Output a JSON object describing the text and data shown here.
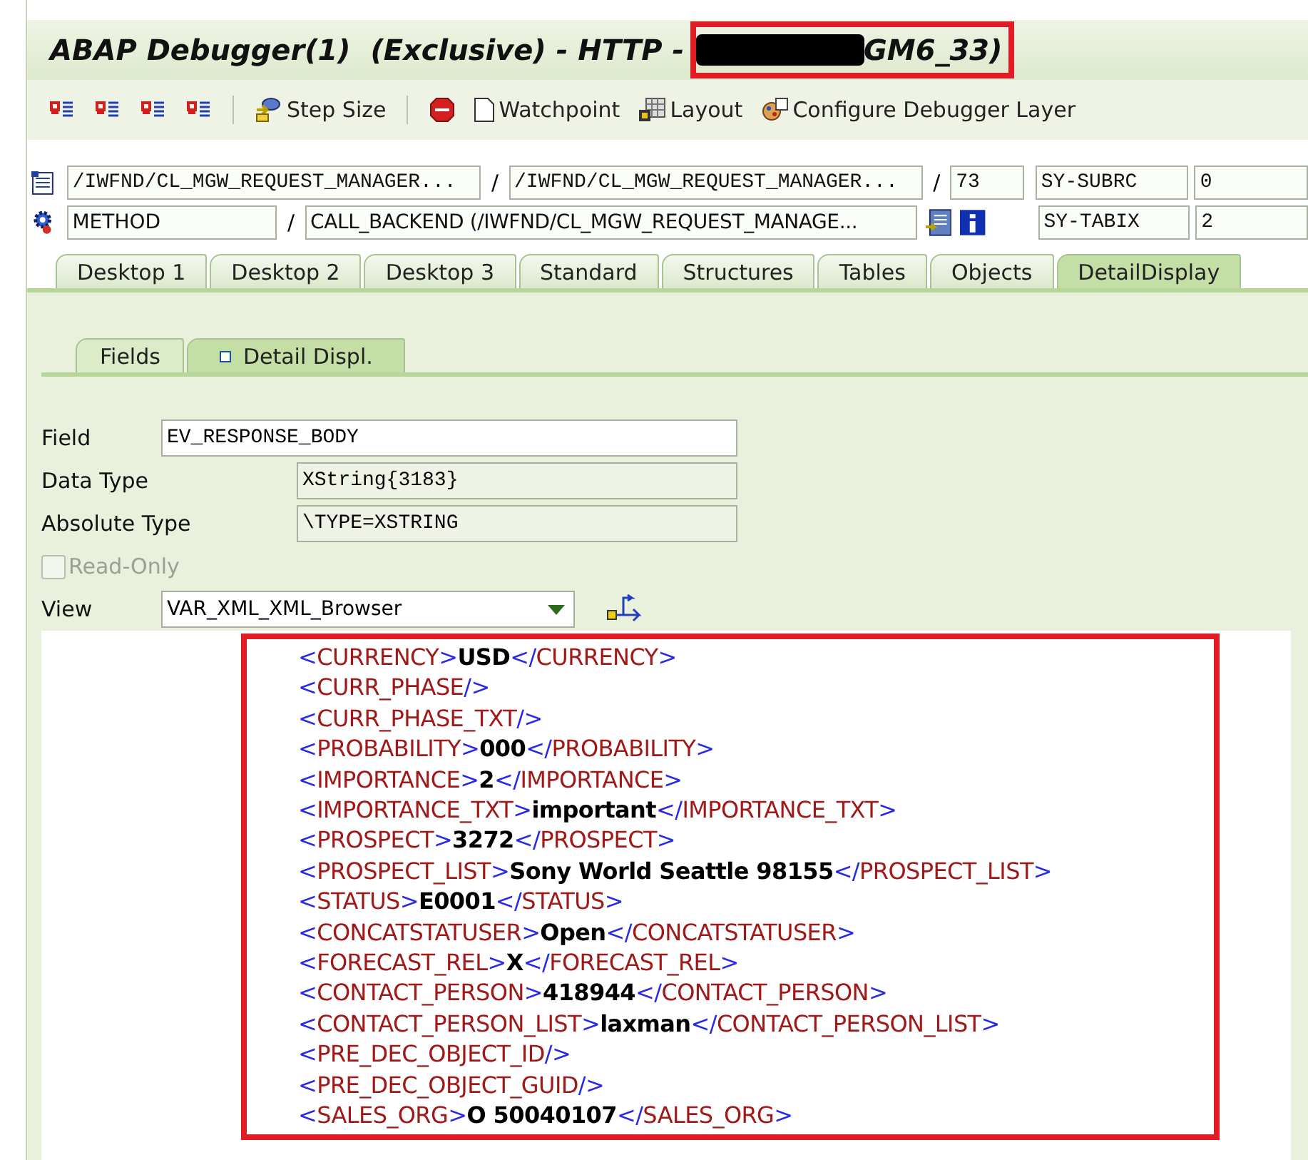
{
  "window": {
    "title": "ABAP Debugger(1)  (Exclusive) - HTTP -",
    "title_suffix": "GM6_33)"
  },
  "toolbar": [
    {
      "label": "Step Size"
    },
    {
      "label": "Watchpoint"
    },
    {
      "label": "Layout"
    },
    {
      "label": "Configure Debugger Layer"
    }
  ],
  "position": {
    "program": "/IWFND/CL_MGW_REQUEST_MANAGER...",
    "include": "/IWFND/CL_MGW_REQUEST_MANAGER...",
    "line": "73",
    "type": "METHOD",
    "routine": "CALL_BACKEND (/IWFND/CL_MGW_REQUEST_MANAGE...",
    "separator": "/",
    "sy": [
      {
        "name": "SY-SUBRC",
        "value": "0"
      },
      {
        "name": "SY-TABIX",
        "value": "2"
      }
    ]
  },
  "tabs": [
    {
      "label": "Desktop 1",
      "selected": false
    },
    {
      "label": "Desktop 2",
      "selected": false
    },
    {
      "label": "Desktop 3",
      "selected": false
    },
    {
      "label": "Standard",
      "selected": false
    },
    {
      "label": "Structures",
      "selected": false
    },
    {
      "label": "Tables",
      "selected": false
    },
    {
      "label": "Objects",
      "selected": false
    },
    {
      "label": "DetailDisplay",
      "selected": true
    }
  ],
  "subtabs": [
    {
      "label": "Fields",
      "selected": false
    },
    {
      "label": "Detail Displ.",
      "selected": true
    }
  ],
  "form": {
    "field_label": "Field",
    "field_value": "EV_RESPONSE_BODY",
    "data_type_label": "Data Type",
    "data_type_value": "XString{3183}",
    "absolute_type_label": "Absolute Type",
    "absolute_type_value": "\\TYPE=XSTRING",
    "read_only": {
      "label": "Read-Only",
      "checked": false,
      "disabled": true
    },
    "view_label": "View",
    "view_value": "VAR_XML_XML_Browser"
  },
  "xml_lines": [
    [
      {
        "kind": "punct",
        "text": "<"
      },
      {
        "kind": "name",
        "text": "CURRENCY"
      },
      {
        "kind": "punct",
        "text": ">"
      },
      {
        "kind": "value",
        "text": "USD"
      },
      {
        "kind": "punct",
        "text": "</"
      },
      {
        "kind": "name",
        "text": "CURRENCY"
      },
      {
        "kind": "punct",
        "text": ">"
      }
    ],
    [
      {
        "kind": "punct",
        "text": "<"
      },
      {
        "kind": "name",
        "text": "CURR_PHASE"
      },
      {
        "kind": "punct",
        "text": "/>"
      }
    ],
    [
      {
        "kind": "punct",
        "text": "<"
      },
      {
        "kind": "name",
        "text": "CURR_PHASE_TXT"
      },
      {
        "kind": "punct",
        "text": "/>"
      }
    ],
    [
      {
        "kind": "punct",
        "text": "<"
      },
      {
        "kind": "name",
        "text": "PROBABILITY"
      },
      {
        "kind": "punct",
        "text": ">"
      },
      {
        "kind": "value",
        "text": "000"
      },
      {
        "kind": "punct",
        "text": "</"
      },
      {
        "kind": "name",
        "text": "PROBABILITY"
      },
      {
        "kind": "punct",
        "text": ">"
      }
    ],
    [
      {
        "kind": "punct",
        "text": "<"
      },
      {
        "kind": "name",
        "text": "IMPORTANCE"
      },
      {
        "kind": "punct",
        "text": ">"
      },
      {
        "kind": "value",
        "text": "2"
      },
      {
        "kind": "punct",
        "text": "</"
      },
      {
        "kind": "name",
        "text": "IMPORTANCE"
      },
      {
        "kind": "punct",
        "text": ">"
      }
    ],
    [
      {
        "kind": "punct",
        "text": "<"
      },
      {
        "kind": "name",
        "text": "IMPORTANCE_TXT"
      },
      {
        "kind": "punct",
        "text": ">"
      },
      {
        "kind": "value",
        "text": "important"
      },
      {
        "kind": "punct",
        "text": "</"
      },
      {
        "kind": "name",
        "text": "IMPORTANCE_TXT"
      },
      {
        "kind": "punct",
        "text": ">"
      }
    ],
    [
      {
        "kind": "punct",
        "text": "<"
      },
      {
        "kind": "name",
        "text": "PROSPECT"
      },
      {
        "kind": "punct",
        "text": ">"
      },
      {
        "kind": "value",
        "text": "3272"
      },
      {
        "kind": "punct",
        "text": "</"
      },
      {
        "kind": "name",
        "text": "PROSPECT"
      },
      {
        "kind": "punct",
        "text": ">"
      }
    ],
    [
      {
        "kind": "punct",
        "text": "<"
      },
      {
        "kind": "name",
        "text": "PROSPECT_LIST"
      },
      {
        "kind": "punct",
        "text": ">"
      },
      {
        "kind": "value",
        "text": "Sony World Seattle 98155"
      },
      {
        "kind": "punct",
        "text": "</"
      },
      {
        "kind": "name",
        "text": "PROSPECT_LIST"
      },
      {
        "kind": "punct",
        "text": ">"
      }
    ],
    [
      {
        "kind": "punct",
        "text": "<"
      },
      {
        "kind": "name",
        "text": "STATUS"
      },
      {
        "kind": "punct",
        "text": ">"
      },
      {
        "kind": "value",
        "text": "E0001"
      },
      {
        "kind": "punct",
        "text": "</"
      },
      {
        "kind": "name",
        "text": "STATUS"
      },
      {
        "kind": "punct",
        "text": ">"
      }
    ],
    [
      {
        "kind": "punct",
        "text": "<"
      },
      {
        "kind": "name",
        "text": "CONCATSTATUSER"
      },
      {
        "kind": "punct",
        "text": ">"
      },
      {
        "kind": "value",
        "text": "Open"
      },
      {
        "kind": "punct",
        "text": "</"
      },
      {
        "kind": "name",
        "text": "CONCATSTATUSER"
      },
      {
        "kind": "punct",
        "text": ">"
      }
    ],
    [
      {
        "kind": "punct",
        "text": "<"
      },
      {
        "kind": "name",
        "text": "FORECAST_REL"
      },
      {
        "kind": "punct",
        "text": ">"
      },
      {
        "kind": "value",
        "text": "X"
      },
      {
        "kind": "punct",
        "text": "</"
      },
      {
        "kind": "name",
        "text": "FORECAST_REL"
      },
      {
        "kind": "punct",
        "text": ">"
      }
    ],
    [
      {
        "kind": "punct",
        "text": "<"
      },
      {
        "kind": "name",
        "text": "CONTACT_PERSON"
      },
      {
        "kind": "punct",
        "text": ">"
      },
      {
        "kind": "value",
        "text": "418944"
      },
      {
        "kind": "punct",
        "text": "</"
      },
      {
        "kind": "name",
        "text": "CONTACT_PERSON"
      },
      {
        "kind": "punct",
        "text": ">"
      }
    ],
    [
      {
        "kind": "punct",
        "text": "<"
      },
      {
        "kind": "name",
        "text": "CONTACT_PERSON_LIST"
      },
      {
        "kind": "punct",
        "text": ">"
      },
      {
        "kind": "value",
        "text": "laxman"
      },
      {
        "kind": "punct",
        "text": "</"
      },
      {
        "kind": "name",
        "text": "CONTACT_PERSON_LIST"
      },
      {
        "kind": "punct",
        "text": ">"
      }
    ],
    [
      {
        "kind": "punct",
        "text": "<"
      },
      {
        "kind": "name",
        "text": "PRE_DEC_OBJECT_ID"
      },
      {
        "kind": "punct",
        "text": "/>"
      }
    ],
    [
      {
        "kind": "punct",
        "text": "<"
      },
      {
        "kind": "name",
        "text": "PRE_DEC_OBJECT_GUID"
      },
      {
        "kind": "punct",
        "text": "/>"
      }
    ],
    [
      {
        "kind": "punct",
        "text": "<"
      },
      {
        "kind": "name",
        "text": "SALES_ORG"
      },
      {
        "kind": "punct",
        "text": ">"
      },
      {
        "kind": "value",
        "text": "O 50040107"
      },
      {
        "kind": "punct",
        "text": "</"
      },
      {
        "kind": "name",
        "text": "SALES_ORG"
      },
      {
        "kind": "punct",
        "text": ">"
      }
    ]
  ]
}
